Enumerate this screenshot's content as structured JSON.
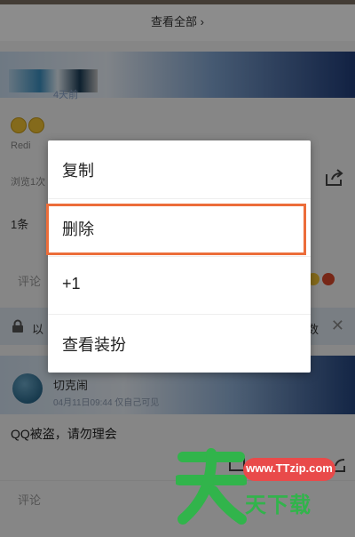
{
  "feed": {
    "view_all": "查看全部 ›",
    "post1": {
      "name_fragment": "4天前",
      "source": "Redi",
      "views": "浏览1次",
      "comment_count": "1条",
      "comment_placeholder": "评论"
    },
    "lock_notice": {
      "left_text": "以",
      "right_text": "数"
    },
    "post2": {
      "name": "切克闹",
      "meta": "04月11日09:44    仅自己可见",
      "text": "QQ被盗，请勿理会",
      "comment_placeholder": "评论"
    }
  },
  "context_menu": {
    "items": [
      {
        "label": "复制"
      },
      {
        "label": "删除",
        "highlighted": true
      },
      {
        "label": "+1"
      },
      {
        "label": "查看装扮"
      }
    ],
    "highlight_color": "#ec6d3a"
  },
  "watermark": {
    "url": "www.TTzip.com",
    "brand_cn": "天下载",
    "logo_icon": "tian-character-logo",
    "pill_color": "#e94a4a",
    "brand_color": "#31b44b"
  }
}
